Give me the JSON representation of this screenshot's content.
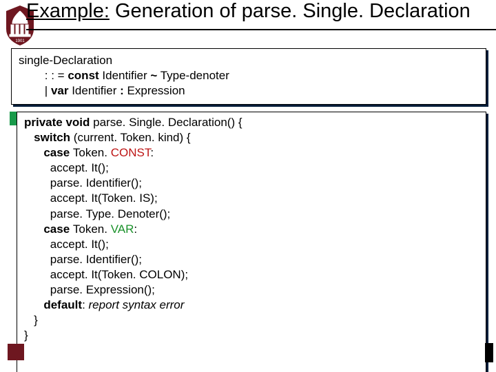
{
  "title": {
    "underlined": "Example:",
    "rest": " Generation of parse. Single. Declaration"
  },
  "grammar": {
    "l1": "single-Declaration",
    "l2_pre": "        : : = ",
    "l2_kw": "const",
    "l2_mid": " Identifier ",
    "l2_tilde": "~",
    "l2_post": " Type-denoter",
    "l3_pre": "        | ",
    "l3_kw": "var",
    "l3_mid": " Identifier ",
    "l3_colon": ":",
    "l3_post": " Expression"
  },
  "code": {
    "l1a": "private void ",
    "l1b": "parse. Single. Declaration() {",
    "l2a": "   switch ",
    "l2b": "(current. Token. kind) {",
    "l3a": "      case ",
    "l3b": "Token. ",
    "l3c": "CONST",
    "l3d": ":",
    "l4": "        accept. It();",
    "l5": "        parse. Identifier();",
    "l6": "        accept. It(Token. IS);",
    "l7": "        parse. Type. Denoter();",
    "l8a": "      case ",
    "l8b": "Token. ",
    "l8c": "VAR",
    "l8d": ":",
    "l9": "        accept. It();",
    "l10": "        parse. Identifier();",
    "l11": "        accept. It(Token. COLON);",
    "l12": "        parse. Expression();",
    "l13a": "      default",
    "l13b": ": ",
    "l13c": "report syntax error",
    "l14": "   }",
    "l15": "}"
  }
}
